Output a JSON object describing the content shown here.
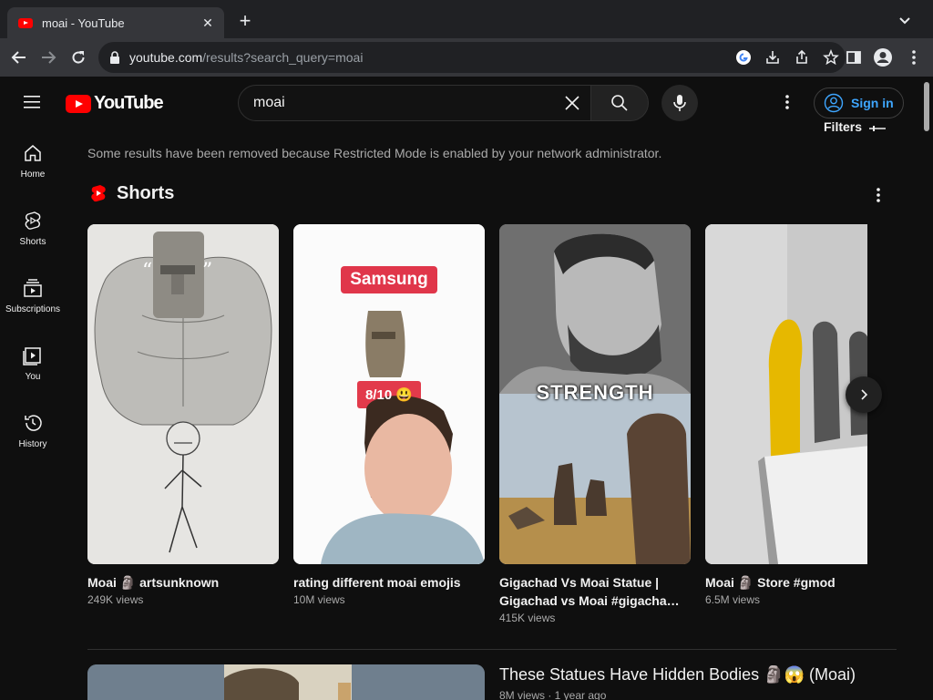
{
  "browser": {
    "tab_title": "moai - YouTube",
    "tab_close": "✕",
    "new_tab": "+",
    "url_host": "youtube.com",
    "url_path": "/results?search_query=moai"
  },
  "masthead": {
    "logo_text": "YouTube",
    "search_query": "moai",
    "sign_in": "Sign in"
  },
  "sidebar": {
    "items": [
      {
        "label": "Home",
        "icon": "home-icon"
      },
      {
        "label": "Shorts",
        "icon": "shorts-icon"
      },
      {
        "label": "Subscriptions",
        "icon": "subscriptions-icon"
      },
      {
        "label": "You",
        "icon": "you-icon"
      },
      {
        "label": "History",
        "icon": "history-icon"
      }
    ]
  },
  "results": {
    "filters": "Filters",
    "notice": "Some results have been removed because Restricted Mode is enabled by your network administrator.",
    "shelf_title": "Shorts",
    "shorts": [
      {
        "title": "Moai 🗿 artsunknown",
        "views": "249K views"
      },
      {
        "title": "rating different moai emojis",
        "views": "10M views",
        "overlay_top": "Samsung",
        "overlay_rating": "8/10 😃"
      },
      {
        "title": "Gigachad Vs Moai Statue | Gigachad vs Moai #gigacha…",
        "views": "415K views",
        "overlay_text": "STRENGTH"
      },
      {
        "title": "Moai 🗿 Store #gmod",
        "views": "6.5M views"
      }
    ],
    "video": {
      "title": "These Statues Have Hidden Bodies 🗿😱 (Moai)",
      "meta": "8M views · 1 year ago"
    }
  },
  "colors": {
    "background": "#0f0f0f",
    "accent_red": "#ff0000",
    "link_blue": "#3ea6ff",
    "chrome_bar": "#35363a"
  }
}
